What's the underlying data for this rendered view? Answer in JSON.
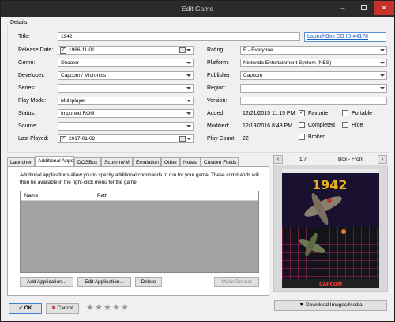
{
  "window": {
    "title": "Edit Game"
  },
  "details": {
    "group_label": "Details",
    "title_label": "Title:",
    "title_value": "1942",
    "launchbox_link": "LaunchBox DB ID #4178",
    "release_date_label": "Release Date:",
    "release_date_value": "1986-11-01",
    "genre_label": "Genre:",
    "genre_value": "Shooter",
    "developer_label": "Developer:",
    "developer_value": "Capcom / Micronics",
    "series_label": "Series:",
    "series_value": "",
    "play_mode_label": "Play Mode:",
    "play_mode_value": "Multiplayer",
    "status_label": "Status:",
    "status_value": "Imported ROM",
    "source_label": "Source:",
    "source_value": "",
    "last_played_label": "Last Played:",
    "last_played_value": "2017-01-02",
    "rating_label": "Rating:",
    "rating_value": "E - Everyone",
    "platform_label": "Platform:",
    "platform_value": "Nintendo Entertainment System (NES)",
    "publisher_label": "Publisher:",
    "publisher_value": "Capcom",
    "region_label": "Region:",
    "region_value": "",
    "version_label": "Version:",
    "version_value": "",
    "added_label": "Added:",
    "added_value": "12/21/2015 11:15 PM",
    "modified_label": "Modified:",
    "modified_value": "12/19/2016 8:48 PM",
    "play_count_label": "Play Count:",
    "play_count_value": "22",
    "favorite_label": "Favorite",
    "favorite_checked": true,
    "completed_label": "Completed",
    "completed_checked": false,
    "broken_label": "Broken",
    "broken_checked": false,
    "portable_label": "Portable",
    "portable_checked": false,
    "hide_label": "Hide",
    "hide_checked": false
  },
  "tabs": [
    "Launcher",
    "Additional Apps",
    "DOSBox",
    "ScummVM",
    "Emulation",
    "Other",
    "Notes",
    "Custom Fields"
  ],
  "active_tab": "Additional Apps",
  "additional_apps": {
    "description": "Additional applications allow you to specify additional commands to run for your game.  These commands will then be available in the right-click menu for the game.",
    "columns": [
      "Name",
      "Path"
    ],
    "add_button": "Add Application...",
    "edit_button": "Edit Application...",
    "delete_button": "Delete",
    "make_default_button": "Make Default"
  },
  "image_panel": {
    "counter": "1/7",
    "image_type": "Box - Front",
    "download_button": "Download Images/Media",
    "boxart_title": "1942",
    "boxart_publisher": "CAPCOM"
  },
  "footer": {
    "ok_button": "OK",
    "cancel_button": "Cancel",
    "rating_stars": 0,
    "max_stars": 5
  },
  "colors": {
    "titlebar": "#2b2b2b",
    "close_button": "#c7312a",
    "link": "#1a5fc6",
    "grid_background": "#a3a3a3",
    "boxart_grid": "#c0207a"
  }
}
